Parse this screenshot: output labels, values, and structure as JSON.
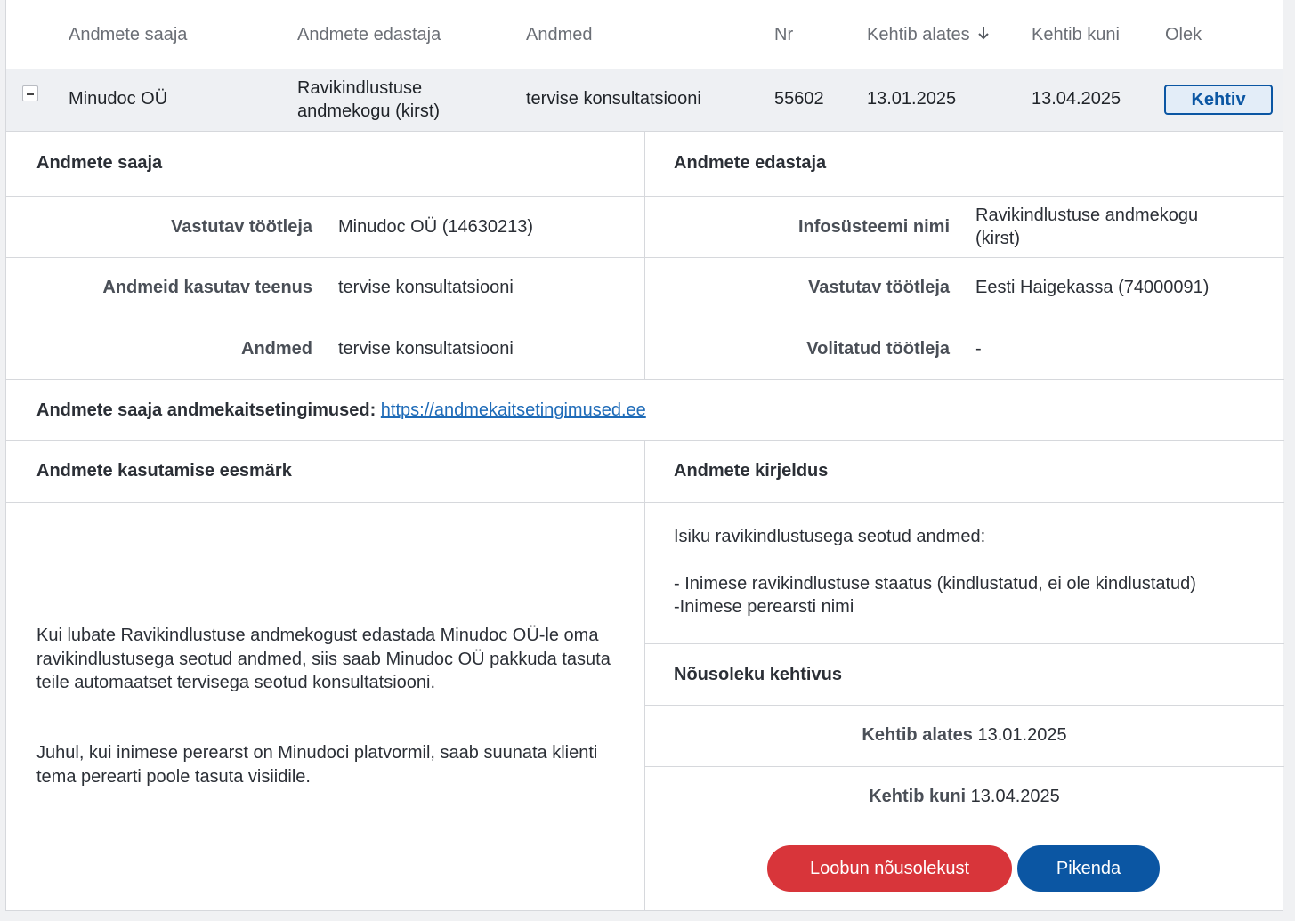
{
  "table": {
    "headers": {
      "recipient": "Andmete saaja",
      "provider": "Andmete edastaja",
      "data": "Andmed",
      "nr": "Nr",
      "valid_from": "Kehtib alates",
      "valid_to": "Kehtib kuni",
      "status": "Olek"
    },
    "row": {
      "recipient": "Minudoc OÜ",
      "provider_line1": "Ravikindlustuse",
      "provider_line2": "andmekogu (kirst)",
      "data": "tervise konsultatsiooni",
      "nr": "55602",
      "valid_from": "13.01.2025",
      "valid_to": "13.04.2025",
      "status": "Kehtiv"
    }
  },
  "recipient_section": {
    "title": "Andmete saaja",
    "responsible_label": "Vastutav töötleja",
    "responsible_value": "Minudoc OÜ (14630213)",
    "service_label": "Andmeid kasutav teenus",
    "service_value": "tervise konsultatsiooni",
    "data_label": "Andmed",
    "data_value": "tervise konsultatsiooni"
  },
  "provider_section": {
    "title": "Andmete edastaja",
    "system_label": "Infosüsteemi nimi",
    "system_value_line1": "Ravikindlustuse andmekogu",
    "system_value_line2": "(kirst)",
    "responsible_label": "Vastutav töötleja",
    "responsible_value": "Eesti Haigekassa (74000091)",
    "authorized_label": "Volitatud töötleja",
    "authorized_value": "-"
  },
  "privacy": {
    "label": "Andmete saaja andmekaitsetingimused:",
    "link": "https://andmekaitsetingimused.ee"
  },
  "purpose": {
    "title": "Andmete kasutamise eesmärk",
    "p1": "Kui lubate Ravikindlustuse andmekogust edastada Minudoc OÜ-le oma ravikindlustusega seotud andmed, siis saab Minudoc OÜ pakkuda tasuta teile automaatset tervisega seotud konsultatsiooni.",
    "p2": "Juhul, kui inimese perearst on Minudoci platvormil, saab suunata klienti tema perearti poole tasuta visiidile."
  },
  "description": {
    "title": "Andmete kirjeldus",
    "line1": "Isiku ravikindlustusega seotud andmed:",
    "line2": "- Inimese ravikindlustuse staatus (kindlustatud, ei ole kindlustatud)",
    "line3": "-Inimese perearsti nimi"
  },
  "validity": {
    "title": "Nõusoleku kehtivus",
    "from_label": "Kehtib alates",
    "from_value": "13.01.2025",
    "to_label": "Kehtib kuni",
    "to_value": "13.04.2025"
  },
  "actions": {
    "revoke": "Loobun nõusolekust",
    "extend": "Pikenda"
  },
  "colors": {
    "primary": "#0b56a3",
    "danger": "#d8353a",
    "link": "#1e6bb8"
  }
}
